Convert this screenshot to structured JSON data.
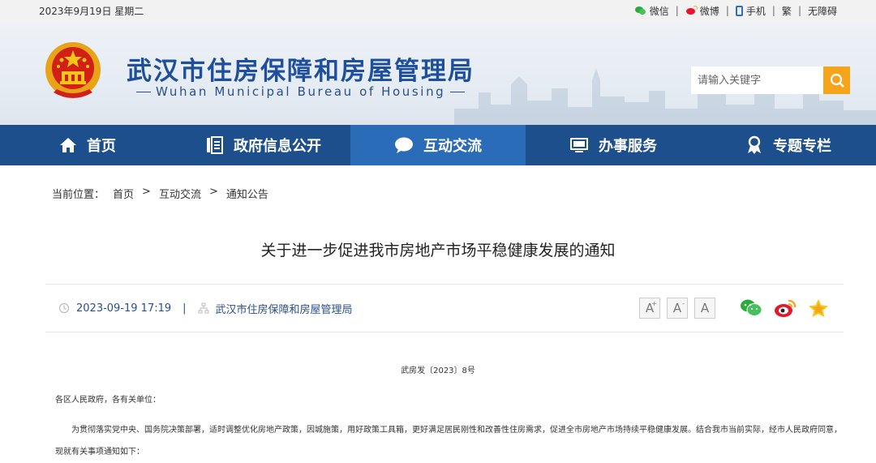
{
  "topbar": {
    "date": "2023年9月19日 星期二",
    "links": [
      "微信",
      "微博",
      "手机",
      "繁",
      "无障碍"
    ],
    "separator": "|"
  },
  "header": {
    "title_cn": "武汉市住房保障和房屋管理局",
    "title_en": "Wuhan Municipal Bureau of Housing",
    "search_placeholder": "请输入关键字"
  },
  "nav": {
    "items": [
      {
        "label": "首页",
        "icon": "home-icon"
      },
      {
        "label": "政府信息公开",
        "icon": "document-list-icon"
      },
      {
        "label": "互动交流",
        "icon": "chat-bubble-icon",
        "active": true
      },
      {
        "label": "办事服务",
        "icon": "monitor-icon"
      },
      {
        "label": "专题专栏",
        "icon": "ribbon-icon"
      }
    ]
  },
  "breadcrumb": {
    "prefix": "当前位置：",
    "items": [
      "首页",
      "互动交流",
      "通知公告"
    ],
    "arrow": ">"
  },
  "article": {
    "title": "关于进一步促进我市房地产市场平稳健康发展的通知",
    "date": "2023-09-19 17:19",
    "meta_sep": "|",
    "source": "武汉市住房保障和房屋管理局",
    "doc_number": "武房发〔2023〕8号",
    "salutation": "各区人民政府，各有关单位：",
    "body_para": "为贯彻落实党中央、国务院决策部署，适时调整优化房地产政策，因城施策，用好政策工具箱，更好满足居民刚性和改善性住房需求，促进全市房地产市场持续平稳健康发展。结合我市当前实际，经市人民政府同意，现就有关事项通知如下："
  },
  "font_tools": {
    "large": "A",
    "medium": "A",
    "small": "A",
    "plus": "+",
    "minus": "-"
  },
  "colors": {
    "nav_bg": "#1c4f8c",
    "nav_active": "#2a6cb7",
    "title_blue": "#1e4f9c",
    "search_btn": "#f5a41c"
  }
}
